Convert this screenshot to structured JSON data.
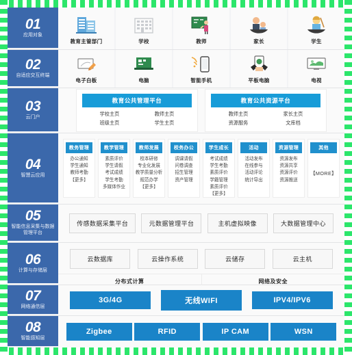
{
  "theme": {
    "frame_color": "#2ce66b",
    "rail_blue": "#3b68ab",
    "header_blue": "#189cd8",
    "app_head_blue": "#2090cd",
    "tag_blue": "#1a84c8",
    "panel_bg": "#fafafa",
    "board_bg": "#f2f3f5"
  },
  "sections": [
    {
      "num": "01",
      "caption": "应用对象"
    },
    {
      "num": "02",
      "caption": "自适应交互终端"
    },
    {
      "num": "03",
      "caption": "云门户"
    },
    {
      "num": "04",
      "caption": "智慧云应用"
    },
    {
      "num": "05",
      "caption": "智能信息采集与数据管理平台"
    },
    {
      "num": "06",
      "caption": "计算与存储层"
    },
    {
      "num": "07",
      "caption": "网络通信层"
    },
    {
      "num": "08",
      "caption": "智能感知层"
    }
  ],
  "row01": {
    "items": [
      {
        "label": "教育主管部门",
        "icon": "government-building-icon"
      },
      {
        "label": "学校",
        "icon": "school-building-icon"
      },
      {
        "label": "教师",
        "icon": "teacher-blackboard-icon"
      },
      {
        "label": "家长",
        "icon": "parent-child-icon"
      },
      {
        "label": "学生",
        "icon": "student-icon"
      }
    ]
  },
  "row02": {
    "items": [
      {
        "label": "电子白板",
        "icon": "whiteboard-icon"
      },
      {
        "label": "电脑",
        "icon": "laptop-icon"
      },
      {
        "label": "智能手机",
        "icon": "smartphone-icon"
      },
      {
        "label": "平板电脑",
        "icon": "tablet-icon"
      },
      {
        "label": "电视",
        "icon": "television-icon"
      }
    ]
  },
  "row03": {
    "portals": [
      {
        "title": "教育公共管理平台",
        "links": [
          "学校主页",
          "教师主页",
          "班级主页",
          "学生主页"
        ]
      },
      {
        "title": "教育公共资源平台",
        "links": [
          "教师主页",
          "家长主页",
          "资源服务",
          "文库档"
        ]
      }
    ]
  },
  "row04": {
    "columns": [
      {
        "title": "教务管理",
        "items": [
          "办公通知",
          "学生通知",
          "教师考勤",
          "【更多】"
        ]
      },
      {
        "title": "教学管理",
        "items": [
          "素质评价",
          "学生请假",
          "考试成绩",
          "学生考勤",
          "多媒体作业"
        ]
      },
      {
        "title": "教师发展",
        "items": [
          "校本研修",
          "专业化发展",
          "教学质量分析",
          "规范办学",
          "【更多】"
        ]
      },
      {
        "title": "校务办公",
        "items": [
          "调课请假",
          "问卷调查",
          "招生管理",
          "资产管理"
        ]
      },
      {
        "title": "学生成长",
        "items": [
          "考试成绩",
          "学生考勤",
          "素质评价",
          "学籍管理",
          "素质评价",
          "【更多】"
        ]
      },
      {
        "title": "活动",
        "items": [
          "活动发布",
          "在线参与",
          "活动评论",
          "统计导出"
        ]
      },
      {
        "title": "资源管理",
        "items": [
          "资源发布",
          "资源共享",
          "资源评价",
          "资源推送"
        ]
      },
      {
        "title": "其他",
        "items": [],
        "more_label": "【MORE】"
      }
    ]
  },
  "row05": {
    "pills": [
      "传感数据采集平台",
      "元数据管理平台",
      "主机虚拟映像",
      "大数据管理中心"
    ]
  },
  "row06": {
    "pills": [
      "云数据库",
      "云操作系统",
      "云储存",
      "云主机"
    ],
    "subbar": [
      "分布式计算",
      "网络及安全"
    ]
  },
  "row07": {
    "tags": [
      "3G/4G",
      "无线WIFI",
      "IPV4/IPV6"
    ]
  },
  "row08": {
    "tags": [
      "Zigbee",
      "RFID",
      "IP CAM",
      "WSN"
    ]
  }
}
